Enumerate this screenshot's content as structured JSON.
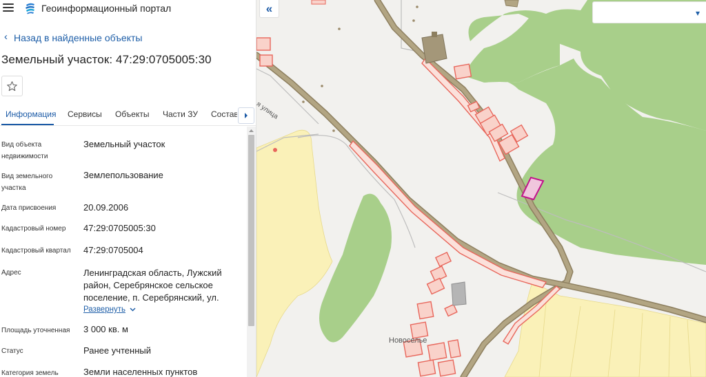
{
  "header": {
    "menu_icon": "hamburger-menu-icon",
    "logo_icon": "geoportal-logo-icon",
    "title": "Геоинформационный портал"
  },
  "nav": {
    "back_label": "Назад в найденные объекты"
  },
  "object": {
    "title": "Земельный участок: 47:29:0705005:30"
  },
  "favorite": {
    "icon": "star-icon"
  },
  "tabs": [
    {
      "label": "Информация",
      "active": true
    },
    {
      "label": "Сервисы"
    },
    {
      "label": "Объекты"
    },
    {
      "label": "Части ЗУ"
    },
    {
      "label": "Состав"
    }
  ],
  "tabs_next_icon": "chevron-right-icon",
  "info": {
    "rows": [
      {
        "label_lines": [
          "Вид объекта",
          "недвижимости"
        ],
        "value": "Земельный участок"
      },
      {
        "label_lines": [
          "Вид земельного",
          "участка"
        ],
        "value": "Землепользование"
      },
      {
        "label_lines": [
          "Дата присвоения"
        ],
        "value": "20.09.2006"
      },
      {
        "label_lines": [
          "Кадастровый номер"
        ],
        "value": "47:29:0705005:30"
      },
      {
        "label_lines": [
          "Кадастровый квартал"
        ],
        "value": "47:29:0705004"
      },
      {
        "label_lines": [
          "Адрес"
        ],
        "value_lines": [
          "Ленинградская область, Лужский",
          "район, Серебрянское сельское",
          "поселение, п. Серебрянский, ул."
        ]
      },
      {
        "label_lines": [
          "Площадь уточненная"
        ],
        "value": "3 000 кв. м"
      },
      {
        "label_lines": [
          "Статус"
        ],
        "value": "Ранее учтенный"
      },
      {
        "label_lines": [
          "Категория земель"
        ],
        "value": "Земли населенных пунктов"
      }
    ],
    "expand_label": "Развернуть"
  },
  "map": {
    "collapse_label": "«",
    "street_label": "я улица",
    "village_label": "Новоселье",
    "colors": {
      "background": "#f2f1ee",
      "forest": "#a8cf8a",
      "field": "#faf1b8",
      "road": "#a49779",
      "parcel_stroke": "#e8665b",
      "parcel_fill": "#f9d2ca",
      "selected_parcel": "#c2128c"
    }
  },
  "search": {
    "value": "",
    "caret_icon": "chevron-down-icon"
  }
}
